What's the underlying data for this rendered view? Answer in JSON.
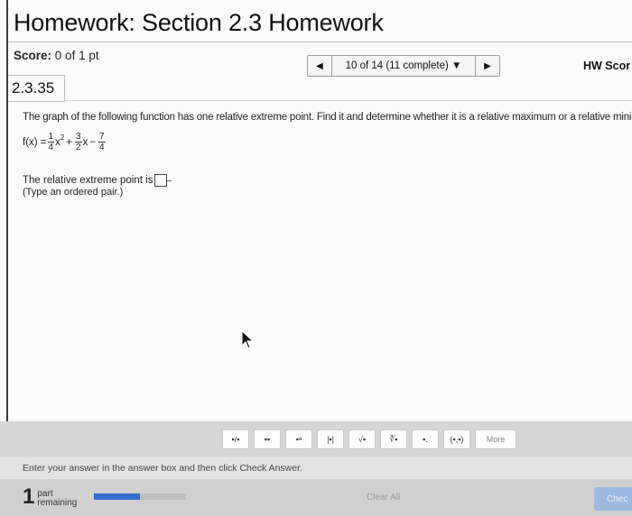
{
  "header": {
    "title": "Homework: Section 2.3 Homework"
  },
  "score": {
    "label": "Score:",
    "value": "0 of 1 pt"
  },
  "nav": {
    "prev": "◀",
    "count": "10 of 14 (11 complete) ▼",
    "next": "▶"
  },
  "hw_score": "HW Scor",
  "question": {
    "number": "2.3.35",
    "prompt": "The graph of the following function has one relative extreme point. Find it and determine whether it is a relative maximum or a relative minir",
    "formula": {
      "lhs": "f(x) =",
      "t1_num": "1",
      "t1_den": "4",
      "t1_var": "x",
      "t1_exp": "2",
      "plus": "+",
      "t2_num": "3",
      "t2_den": "2",
      "t2_var": "x",
      "minus": "−",
      "t3_num": "7",
      "t3_den": "4"
    },
    "answer_label": "The relative extreme point is",
    "hint": "(Type an ordered pair.)"
  },
  "toolbar": {
    "buttons": [
      "▪/▪",
      "▪▪",
      "▪ᵃ",
      "|▪|",
      "√▪",
      "∛▪",
      "▪.",
      "(▪,▪)",
      "More"
    ]
  },
  "instructions": "Enter your answer in the answer box and then click Check Answer.",
  "footer": {
    "parts_number": "1",
    "parts_label_1": "part",
    "parts_label_2": "remaining",
    "progress": 0.5,
    "clear_all": "Clear All",
    "check": "Chec"
  }
}
